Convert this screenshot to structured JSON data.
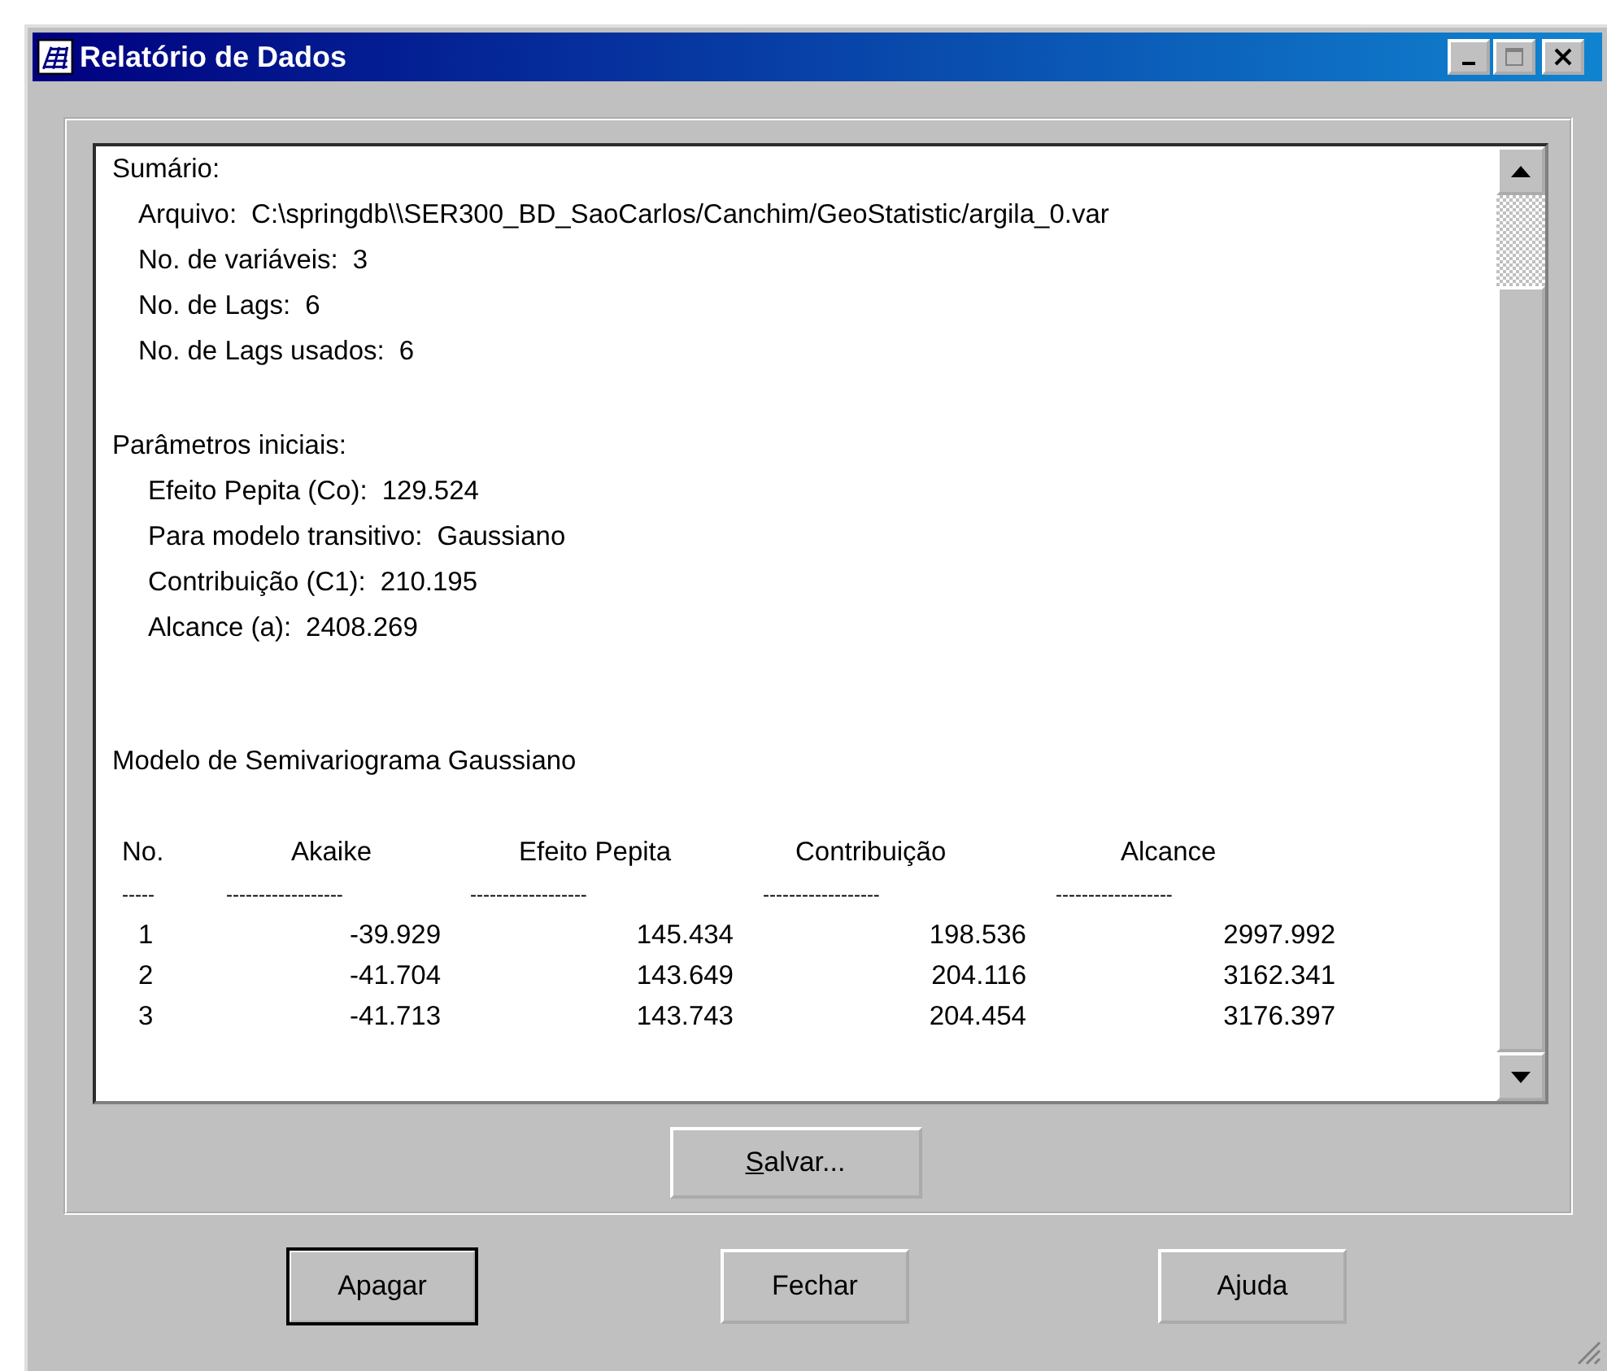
{
  "window": {
    "title": "Relatório de Dados"
  },
  "report": {
    "summary_heading": "Sumário:",
    "summary": [
      {
        "label": "Arquivo:",
        "value": "C:\\springdb\\\\SER300_BD_SaoCarlos/Canchim/GeoStatistic/argila_0.var"
      },
      {
        "label": "No. de variáveis:",
        "value": "3"
      },
      {
        "label": "No. de Lags:",
        "value": "6"
      },
      {
        "label": "No. de Lags usados:",
        "value": "6"
      }
    ],
    "params_heading": "Parâmetros iniciais:",
    "params": [
      {
        "label": "Efeito Pepita (Co):",
        "value": "129.524"
      },
      {
        "label": "Para modelo transitivo:",
        "value": "Gaussiano"
      },
      {
        "label": "Contribuição (C1):",
        "value": "210.195"
      },
      {
        "label": "Alcance (a):",
        "value": "2408.269"
      }
    ],
    "model_heading": "Modelo de Semivariograma Gaussiano",
    "table": {
      "columns": [
        "No.",
        "Akaike",
        "Efeito Pepita",
        "Contribuição",
        "Alcance"
      ],
      "separators": [
        "-----",
        "------------------",
        "------------------",
        "------------------",
        "------------------"
      ],
      "rows": [
        [
          "1",
          "-39.929",
          "145.434",
          "198.536",
          "2997.992"
        ],
        [
          "2",
          "-41.704",
          "143.649",
          "204.116",
          "3162.341"
        ],
        [
          "3",
          "-41.713",
          "143.743",
          "204.454",
          "3176.397"
        ]
      ]
    }
  },
  "save_button": "Salvar...",
  "buttons": [
    {
      "label": "Apagar",
      "default": true
    },
    {
      "label": "Fechar",
      "default": false
    },
    {
      "label": "Ajuda",
      "default": false
    }
  ]
}
